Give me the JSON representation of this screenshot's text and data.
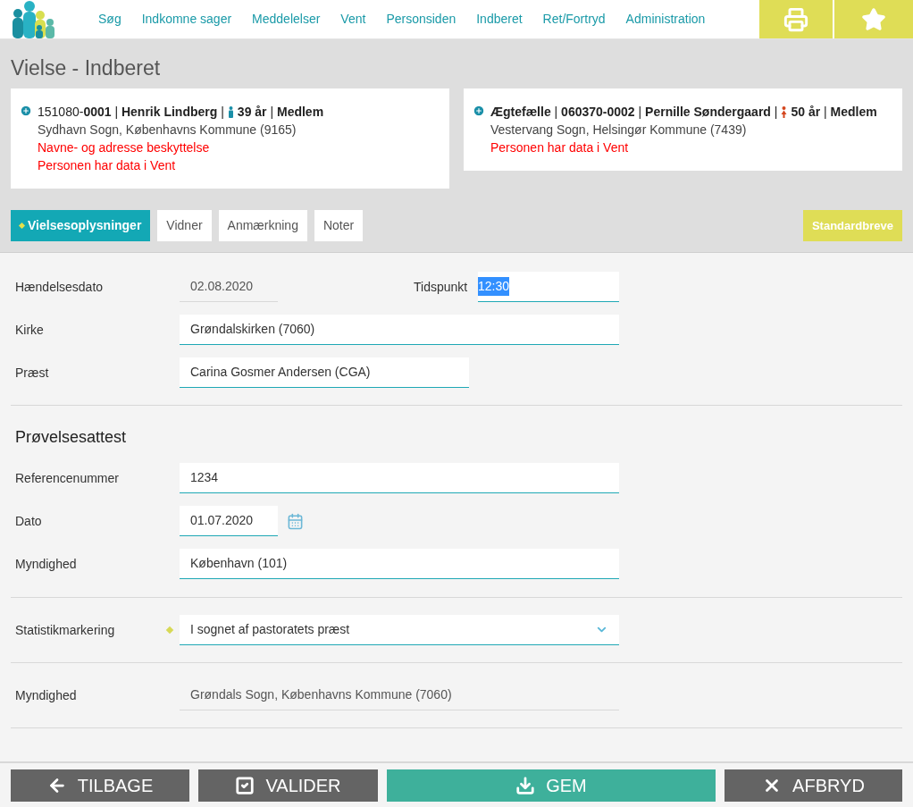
{
  "nav": {
    "items": [
      "Søg",
      "Indkomne sager",
      "Meddelelser",
      "Vent",
      "Personsiden",
      "Indberet",
      "Ret/Fortryd",
      "Administration"
    ]
  },
  "page_title": "Vielse - Indberet",
  "persons": [
    {
      "kind": "male",
      "summary": "151080-**0001** | **Henrik Lindberg** |",
      "summary_after_icon": "**39 år** | **Medlem**",
      "address": "Sydhavn Sogn, Københavns Kommune (9165)",
      "warnings": [
        "Navne- og adresse beskyttelse",
        "Personen har data i Vent"
      ]
    },
    {
      "kind": "female",
      "summary": "**Ægtefælle** | **060370-0002** | **Pernille Søndergaard** |",
      "summary_after_icon": "**50 år** | **Medlem**",
      "address": "Vestervang Sogn, Helsingør Kommune (7439)",
      "warnings": [
        "Personen har data i Vent"
      ]
    }
  ],
  "tabs": [
    {
      "label": "Vielsesoplysninger",
      "selected": true,
      "marked": true
    },
    {
      "label": "Vidner",
      "selected": false,
      "marked": false
    },
    {
      "label": "Anmærkning",
      "selected": false,
      "marked": false
    },
    {
      "label": "Noter",
      "selected": false,
      "marked": false
    }
  ],
  "letters_button": "Standardbreve",
  "sections": [
    {
      "rows": [
        {
          "label": "Hændelsesdato",
          "kind": "readonly",
          "value": "02.08.2020",
          "side": {
            "label": "Tidspunkt",
            "value": "12:30",
            "text_selected": true
          }
        },
        {
          "label": "Kirke",
          "kind": "input",
          "value": "Grøndalskirken (7060)"
        },
        {
          "label": "Præst",
          "kind": "input",
          "value": "Carina Gosmer Andersen (CGA)"
        }
      ]
    },
    {
      "title": "Prøvelsesattest",
      "rows": [
        {
          "label": "Referencenummer",
          "kind": "input",
          "value": "1234"
        },
        {
          "label": "Dato",
          "kind": "date",
          "value": "01.07.2020"
        },
        {
          "label": "Myndighed",
          "kind": "input",
          "value": "København (101)"
        }
      ]
    },
    {
      "rows": [
        {
          "label": "Statistikmarkering",
          "kind": "select",
          "value": "I sognet af pastoratets præst",
          "marked": true
        }
      ]
    },
    {
      "rows": [
        {
          "label": "Myndighed",
          "kind": "readonly",
          "value": "Grøndals Sogn, Københavns Kommune (7060)"
        }
      ]
    }
  ],
  "actions": [
    {
      "label": "TILBAGE",
      "kind": "back"
    },
    {
      "label": "VALIDER",
      "kind": "validate"
    },
    {
      "label": "GEM",
      "kind": "save"
    },
    {
      "label": "AFBRYD",
      "kind": "cancel"
    }
  ]
}
